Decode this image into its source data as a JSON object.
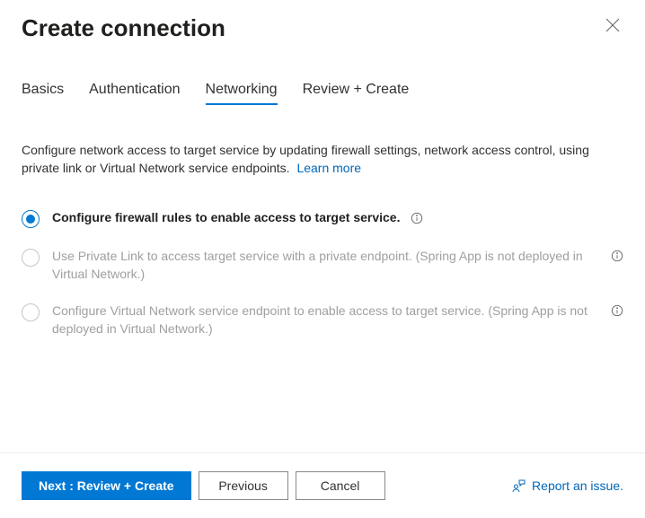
{
  "header": {
    "title": "Create connection"
  },
  "tabs": [
    {
      "label": "Basics",
      "active": false
    },
    {
      "label": "Authentication",
      "active": false
    },
    {
      "label": "Networking",
      "active": true
    },
    {
      "label": "Review + Create",
      "active": false
    }
  ],
  "description": "Configure network access to target service by updating firewall settings, network access control, using private link or Virtual Network service endpoints.",
  "learn_more": "Learn more",
  "options": [
    {
      "label": "Configure firewall rules to enable access to target service.",
      "selected": true,
      "disabled": false,
      "info_position": "inline"
    },
    {
      "label": "Use Private Link to access target service with a private endpoint. (Spring App is not deployed in Virtual Network.)",
      "selected": false,
      "disabled": true,
      "info_position": "right"
    },
    {
      "label": "Configure Virtual Network service endpoint to enable access to target service. (Spring App is not deployed in Virtual Network.)",
      "selected": false,
      "disabled": true,
      "info_position": "right"
    }
  ],
  "footer": {
    "next": "Next : Review + Create",
    "previous": "Previous",
    "cancel": "Cancel",
    "report": "Report an issue."
  }
}
